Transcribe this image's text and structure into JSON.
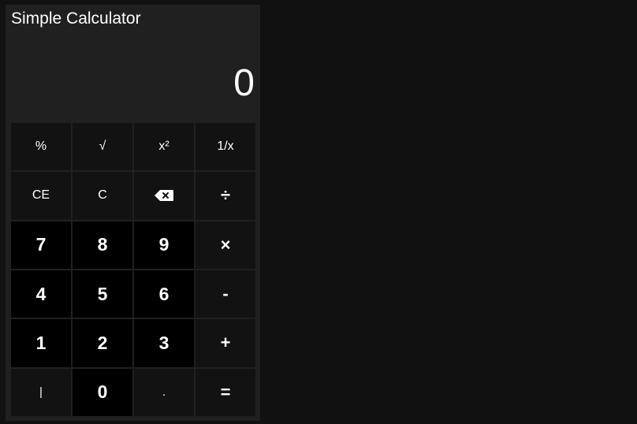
{
  "app": {
    "title": "Simple Calculator",
    "display_value": "0"
  },
  "keys": {
    "row1": [
      "%",
      "√",
      "x²",
      "1/x"
    ],
    "row2": [
      "CE",
      "C",
      "backspace",
      "÷"
    ],
    "row3": [
      "7",
      "8",
      "9",
      "×"
    ],
    "row4": [
      "4",
      "5",
      "6",
      "-"
    ],
    "row5": [
      "1",
      "2",
      "3",
      "+"
    ],
    "row6": [
      "|",
      "0",
      ".",
      "="
    ]
  },
  "icons": {
    "backspace": "backspace-icon"
  },
  "colors": {
    "page_bg": "#111111",
    "panel_bg": "#202020",
    "function_key_bg": "#121212",
    "number_key_bg": "#000000",
    "text": "#ffffff"
  }
}
